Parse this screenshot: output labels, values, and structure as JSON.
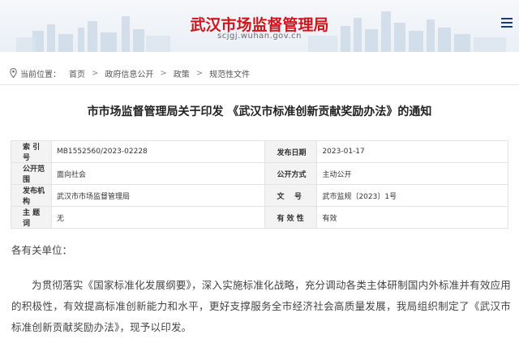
{
  "header": {
    "site_title": "武汉市场监督管理局",
    "site_url": "scjgj.wuhan.gov.cn",
    "menu_icon": "hamburger-menu-icon"
  },
  "breadcrumb": {
    "prefix": "当前位置：",
    "items": [
      "首页",
      "政府信息公开",
      "政策",
      "规范性文件"
    ]
  },
  "document": {
    "title": "市市场监督管理局关于印发 《武汉市标准创新贡献奖励办法》的通知",
    "meta": {
      "index_label": "索 引 号",
      "index_value": "MB1552560/2023-02228",
      "date_label": "发布日期",
      "date_value": "2023-01-17",
      "scope_label": "公开范围",
      "scope_value": "面向社会",
      "method_label": "公开方式",
      "method_value": "主动公开",
      "agency_label": "发布机构",
      "agency_value": "武汉市市场监督管理局",
      "docno_label": "文    号",
      "docno_value": "武市监规〔2023〕1号",
      "topic_label": "主 题 词",
      "topic_value": "无",
      "validity_label": "有 效 性",
      "validity_value": "有效"
    },
    "salutation": "各有关单位：",
    "paragraph": "为贯彻落实《国家标准化发展纲要》，深入实施标准化战略，充分调动各类主体研制国内外标准并有效应用的积极性，有效提高标准创新能力和水平，更好支撑服务全市经济社会高质量发展，我局组织制定了《武汉市标准创新贡献奖励办法》，现予以印发。"
  },
  "colors": {
    "title_red": "#d3121a",
    "nav_blue": "#1a3d7a",
    "key_cell_bg": "#f3f3f3"
  }
}
